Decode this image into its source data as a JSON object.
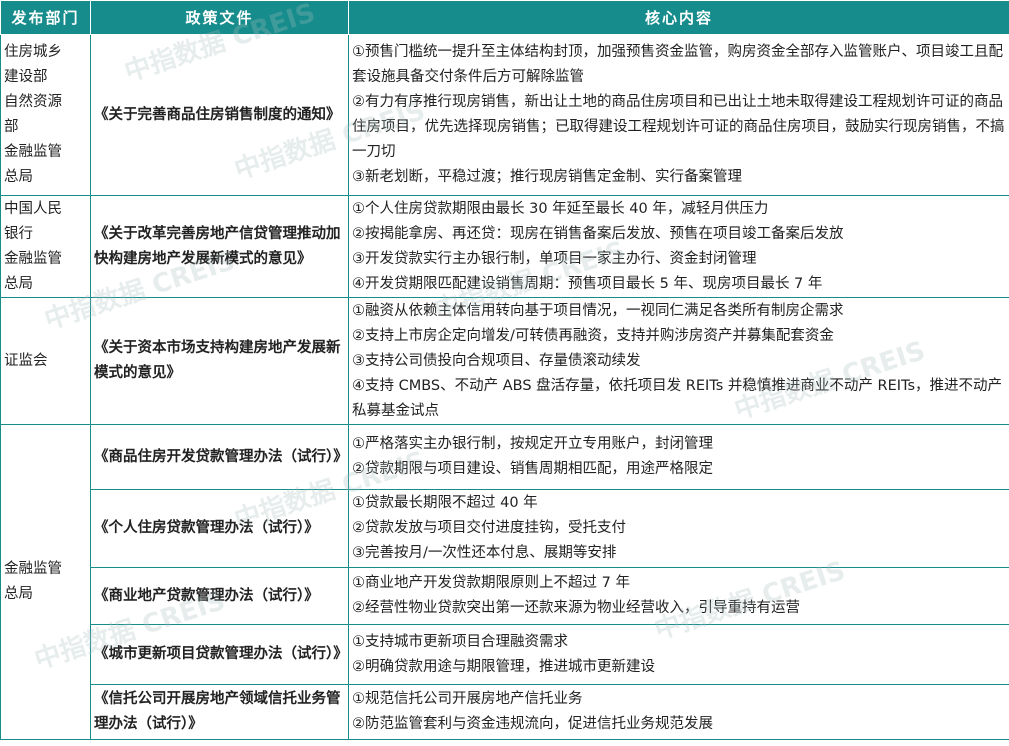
{
  "header": {
    "col1": "发布部门",
    "col2": "政策文件",
    "col3": "核心内容"
  },
  "rows": [
    {
      "dept": "住房城乡\n建设部\n自然资源\n部\n金融监管\n总局",
      "doc": "《关于完善商品住房销售制度的通知》",
      "lines": [
        "①预售门槛统一提升至主体结构封顶，加强预售资金监管，购房资金全部存入监管账户、项目竣工且配套设施具备交付条件后方可解除监管",
        "②有力有序推行现房销售，新出让土地的商品住房项目和已出让土地未取得建设工程规划许可证的商品住房项目，优先选择现房销售；已取得建设工程规划许可证的商品住房项目，鼓励实行现房销售，不搞一刀切",
        "③新老划断，平稳过渡；推行现房销售定金制、实行备案管理"
      ]
    },
    {
      "dept": "中国人民\n银行\n金融监管\n总局",
      "doc": "《关于改革完善房地产信贷管理推动加快构建房地产发展新模式的意见》",
      "lines": [
        "①个人住房贷款期限由最长 30 年延至最长 40 年，减轻月供压力",
        "②按揭能拿房、再还贷：现房在销售备案后发放、预售在项目竣工备案后发放",
        "③开发贷款实行主办银行制，单项目一家主办行、资金封闭管理",
        "④开发贷期限匹配建设销售周期：预售项目最长 5 年、现房项目最长 7 年"
      ]
    },
    {
      "dept": "证监会",
      "doc": "《关于资本市场支持构建房地产发展新模式的意见》",
      "lines": [
        "①融资从依赖主体信用转向基于项目情况，一视同仁满足各类所有制房企需求",
        "②支持上市房企定向增发/可转债再融资，支持并购涉房资产并募集配套资金",
        "③支持公司债投向合规项目、存量债滚动续发",
        "④支持 CMBS、不动产 ABS 盘活存量，依托项目发 REITs 并稳慎推进商业不动产 REITs，推进不动产私募基金试点"
      ]
    },
    {
      "dept": "金融监管\n总局",
      "doc": "《商品住房开发贷款管理办法（试行）》",
      "lines": [
        "①严格落实主办银行制，按规定开立专用账户，封闭管理",
        "②贷款期限与项目建设、销售周期相匹配，用途严格限定"
      ]
    },
    {
      "doc": "《个人住房贷款管理办法（试行）》",
      "lines": [
        "①贷款最长期限不超过 40 年",
        "②贷款发放与项目交付进度挂钩，受托支付",
        "③完善按月/一次性还本付息、展期等安排"
      ]
    },
    {
      "doc": "《商业地产贷款管理办法（试行）》",
      "lines": [
        "①商业地产开发贷款期限原则上不超过 7 年",
        "②经营性物业贷款突出第一还款来源为物业经营收入，引导重持有运营"
      ]
    },
    {
      "doc": "《城市更新项目贷款管理办法（试行）》",
      "lines": [
        "①支持城市更新项目合理融资需求",
        "②明确贷款用途与期限管理，推进城市更新建设"
      ]
    },
    {
      "doc": "《信托公司开展房地产领域信托业务管理办法（试行）》",
      "lines": [
        "①规范信托公司开展房地产信托业务",
        "②防范监管套利与资金违规流向，促进信托业务规范发展"
      ]
    }
  ],
  "watermark": "中指数据 CREIS",
  "colors": {
    "header_bg": "#178c8c",
    "border": "#178c8c",
    "doc_text": "#c8151d"
  }
}
